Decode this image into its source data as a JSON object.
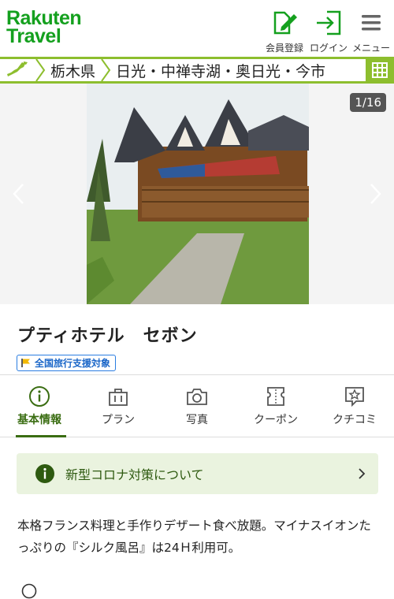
{
  "header": {
    "logo_line1": "Rakuten",
    "logo_line2": "Travel",
    "register_label": "会員登録",
    "login_label": "ログイン",
    "menu_label": "メニュー"
  },
  "breadcrumb": {
    "items": [
      "栃木県",
      "日光・中禅寺湖・奥日光・今市"
    ]
  },
  "gallery": {
    "counter": "1/16"
  },
  "hotel": {
    "name": "プティホテル　セボン",
    "badge": "全国旅行支援対象"
  },
  "tabs": [
    {
      "label": "基本情報",
      "icon": "info-icon"
    },
    {
      "label": "プラン",
      "icon": "bag-icon"
    },
    {
      "label": "写真",
      "icon": "camera-icon"
    },
    {
      "label": "クーポン",
      "icon": "ticket-icon"
    },
    {
      "label": "クチコミ",
      "icon": "review-icon"
    }
  ],
  "notice": {
    "label": "新型コロナ対策について"
  },
  "description": "本格フランス料理と手作りデザート食べ放題。マイナスイオンたっぷりの『シルク風呂』は24Ｈ利用可。",
  "colors": {
    "brand_green": "#14a01e",
    "breadcrumb_green": "#8dbe2e",
    "tab_active": "#3a6d12",
    "notice_bg": "#eaf3df"
  }
}
